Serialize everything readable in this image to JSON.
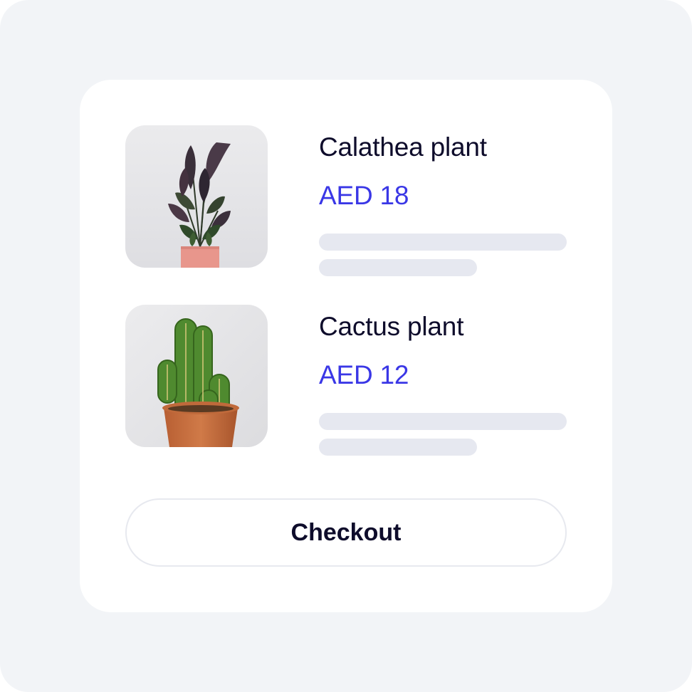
{
  "cart": {
    "items": [
      {
        "name": "Calathea plant",
        "price": "AED 18",
        "image_icon": "calathea-plant-image",
        "pot_color": "#e8968c"
      },
      {
        "name": "Cactus plant",
        "price": "AED 12",
        "image_icon": "cactus-plant-image",
        "pot_color": "#c8703f"
      }
    ],
    "checkout_label": "Checkout"
  },
  "colors": {
    "background": "#f2f4f7",
    "card": "#ffffff",
    "text": "#0e0c2b",
    "price_accent": "#3a37e6",
    "skeleton": "#e6e8f0"
  }
}
